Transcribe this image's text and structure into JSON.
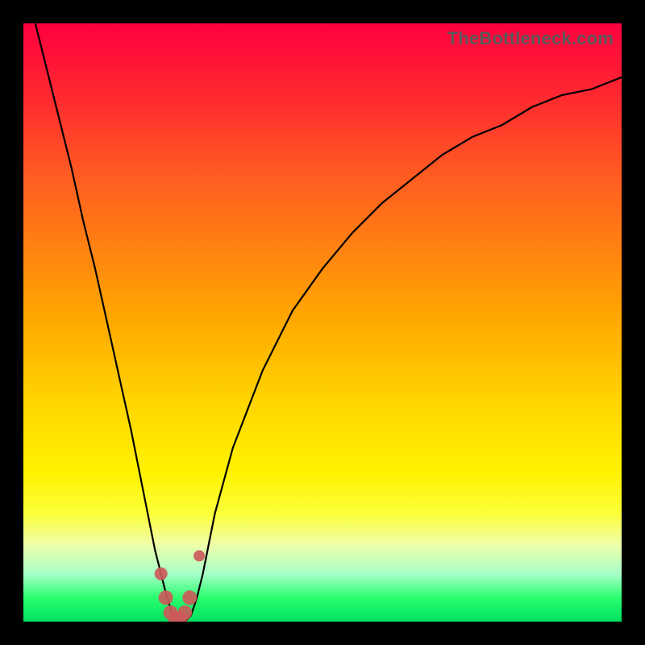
{
  "watermark": "TheBottleneck.com",
  "colors": {
    "frame": "#000000",
    "curve": "#000000",
    "marker": "#cc5a5a",
    "gradient_stops": [
      "#ff003e",
      "#ff2830",
      "#ff5a22",
      "#ff8012",
      "#ffaa00",
      "#ffd400",
      "#fff200",
      "#fcff3a",
      "#f0ffa8",
      "#a8ffca",
      "#2aff6e",
      "#00e060"
    ]
  },
  "chart_data": {
    "type": "line",
    "title": "",
    "xlabel": "",
    "ylabel": "",
    "x_range": [
      0,
      100
    ],
    "y_range": [
      0,
      100
    ],
    "x": [
      0,
      2,
      4,
      6,
      8,
      10,
      12,
      14,
      16,
      18,
      20,
      22,
      23,
      24,
      25,
      26,
      27,
      28,
      29,
      30,
      32,
      35,
      40,
      45,
      50,
      55,
      60,
      65,
      70,
      75,
      80,
      85,
      90,
      95,
      100
    ],
    "series": [
      {
        "name": "bottleneck-curve",
        "values": [
          108,
          100,
          92,
          84,
          76,
          67,
          59,
          50,
          41,
          32,
          22,
          12,
          8,
          4,
          1,
          0,
          0,
          1,
          4,
          8,
          18,
          29,
          42,
          52,
          59,
          65,
          70,
          74,
          78,
          81,
          83,
          86,
          88,
          89,
          91
        ]
      }
    ],
    "markers": {
      "name": "highlight-band",
      "x": [
        23.0,
        23.8,
        24.6,
        25.4,
        26.2,
        27.0,
        27.8,
        29.4
      ],
      "y": [
        8,
        4,
        1.5,
        0.5,
        0.5,
        1.5,
        4,
        11
      ],
      "r": [
        8,
        9,
        9,
        9,
        9,
        9,
        9,
        7
      ]
    }
  }
}
